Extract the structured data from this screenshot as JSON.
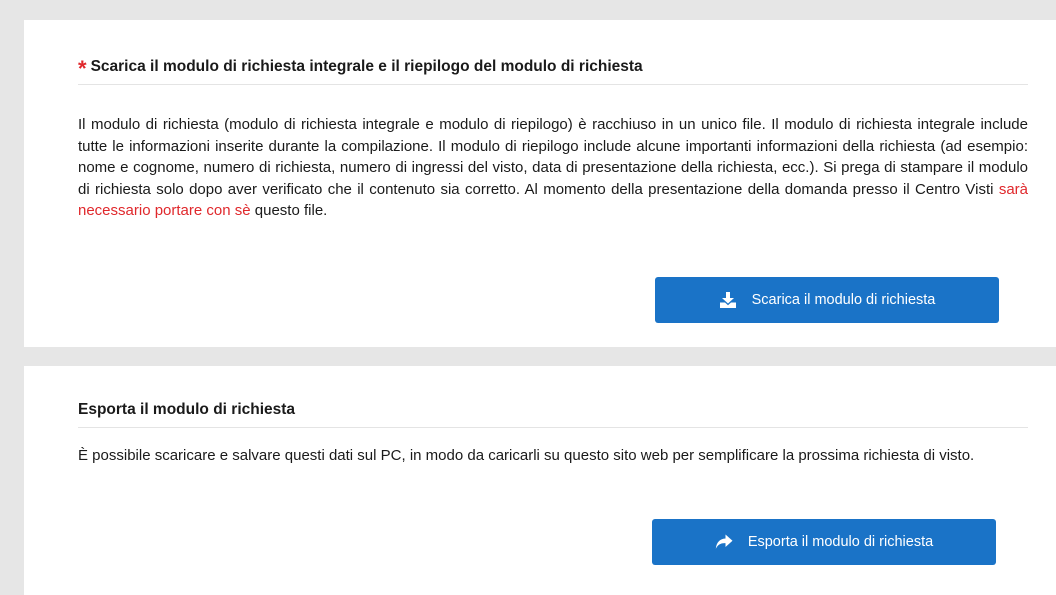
{
  "download_section": {
    "required_marker": "*",
    "title": "Scarica il modulo di richiesta integrale e il riepilogo del modulo di richiesta",
    "paragraph_before_highlight": "Il modulo di richiesta (modulo di richiesta integrale e modulo di riepilogo) è racchiuso in un unico file. Il modulo di richiesta integrale include tutte le informazioni inserite durante la compilazione. Il modulo di riepilogo include alcune importanti informazioni della richiesta (ad esempio: nome e cognome, numero di richiesta, numero di ingressi del visto, data di presentazione della richiesta, ecc.). Si prega di stampare il modulo di richiesta solo dopo aver verificato che il contenuto sia corretto. Al momento della presentazione della domanda presso il Centro Visti ",
    "paragraph_highlight": "sarà necessario portare con sè",
    "paragraph_after_highlight": " questo file.",
    "button_label": "Scarica il modulo di richiesta",
    "button_icon": "download-icon"
  },
  "export_section": {
    "title": "Esporta il modulo di richiesta",
    "paragraph": "È possibile scaricare e salvare questi dati sul PC, in modo da caricarli su questo sito web per semplificare la prossima richiesta di visto.",
    "button_label": "Esporta il modulo di richiesta",
    "button_icon": "share-arrow-icon"
  },
  "colors": {
    "button_blue": "#1a73c7",
    "highlight_red": "#e0282c",
    "page_gray": "#e6e6e6"
  }
}
